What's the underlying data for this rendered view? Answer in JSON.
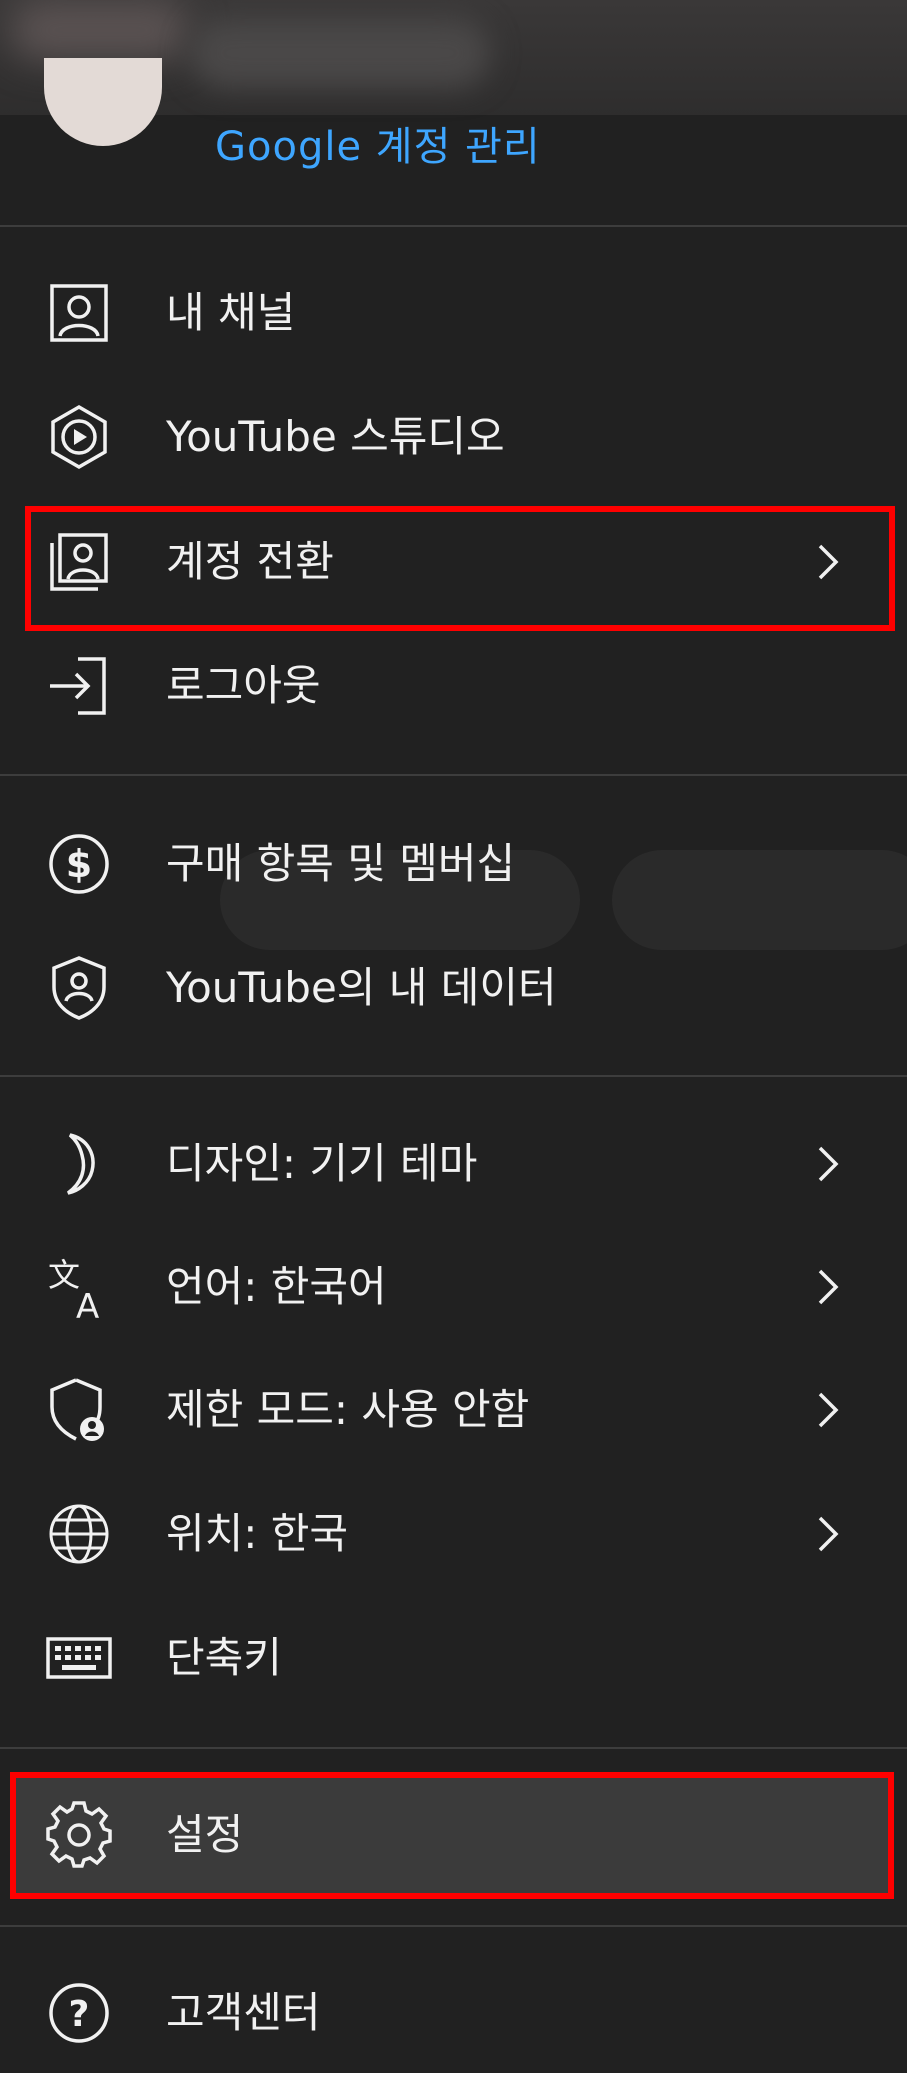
{
  "account": {
    "manage_link": "Google 계정 관리"
  },
  "menu": {
    "section1": [
      {
        "label": "내 채널",
        "icon": "account-box-icon"
      },
      {
        "label": "YouTube 스튜디오",
        "icon": "studio-icon"
      },
      {
        "label": "계정 전환",
        "icon": "switch-account-icon"
      },
      {
        "label": "로그아웃",
        "icon": "sign-out-icon"
      }
    ],
    "section2": [
      {
        "label": "구매 항목 및 멤버십",
        "icon": "dollar-circle-icon"
      },
      {
        "label": "YouTube의 내 데이터",
        "icon": "shield-user-icon"
      }
    ],
    "section3": [
      {
        "label": "디자인: 기기 테마",
        "icon": "moon-icon"
      },
      {
        "label": "언어: 한국어",
        "icon": "translate-icon"
      },
      {
        "label": "제한 모드: 사용 안함",
        "icon": "restricted-shield-icon"
      },
      {
        "label": "위치: 한국",
        "icon": "globe-icon"
      },
      {
        "label": "단축키",
        "icon": "keyboard-icon"
      }
    ],
    "section4": [
      {
        "label": "설정",
        "icon": "gear-icon"
      }
    ],
    "section5": [
      {
        "label": "고객센터",
        "icon": "help-icon"
      }
    ]
  },
  "colors": {
    "background": "#212121",
    "link": "#3ea6ff",
    "highlight_box": "#ff0000",
    "selected_row": "#3b3b3b"
  }
}
